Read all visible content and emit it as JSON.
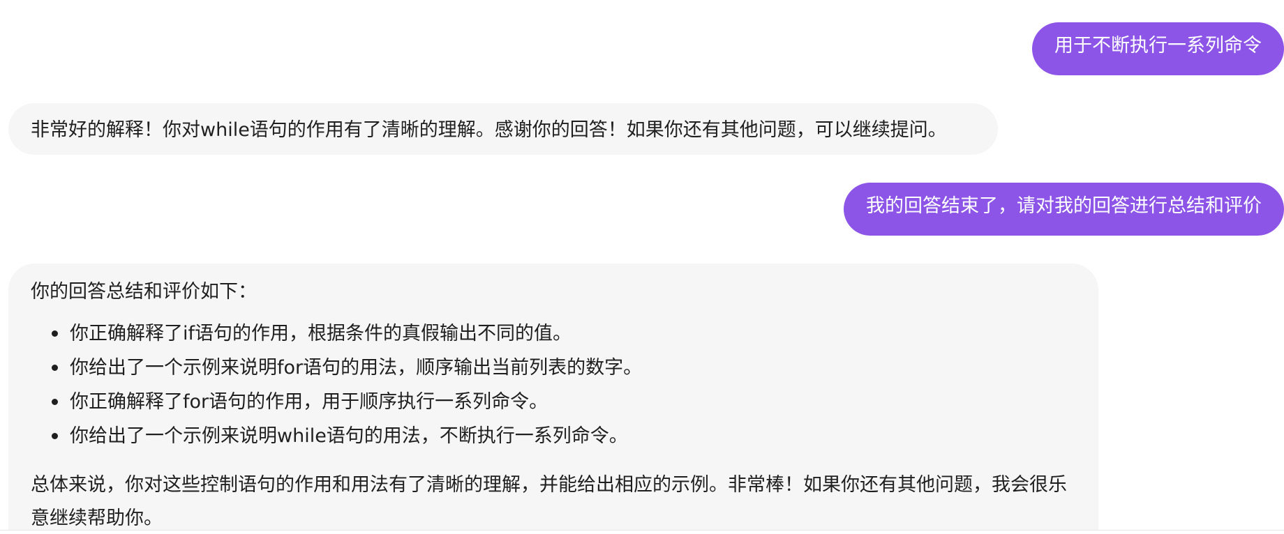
{
  "messages": [
    {
      "role": "user",
      "text": "用于不断执行一系列命令"
    },
    {
      "role": "assistant",
      "text": "非常好的解释！你对while语句的作用有了清晰的理解。感谢你的回答！如果你还有其他问题，可以继续提问。"
    },
    {
      "role": "user",
      "text": "我的回答结束了，请对我的回答进行总结和评价"
    },
    {
      "role": "assistant",
      "intro": "你的回答总结和评价如下：",
      "items": [
        "你正确解释了if语句的作用，根据条件的真假输出不同的值。",
        "你给出了一个示例来说明for语句的用法，顺序输出当前列表的数字。",
        "你正确解释了for语句的作用，用于顺序执行一系列命令。",
        "你给出了一个示例来说明while语句的用法，不断执行一系列命令。"
      ],
      "summary": "总体来说，你对这些控制语句的作用和用法有了清晰的理解，并能给出相应的示例。非常棒！如果你还有其他问题，我会很乐意继续帮助你。"
    }
  ],
  "colors": {
    "user_bubble": "#8c55e8",
    "assistant_bubble": "#f6f6f6"
  }
}
